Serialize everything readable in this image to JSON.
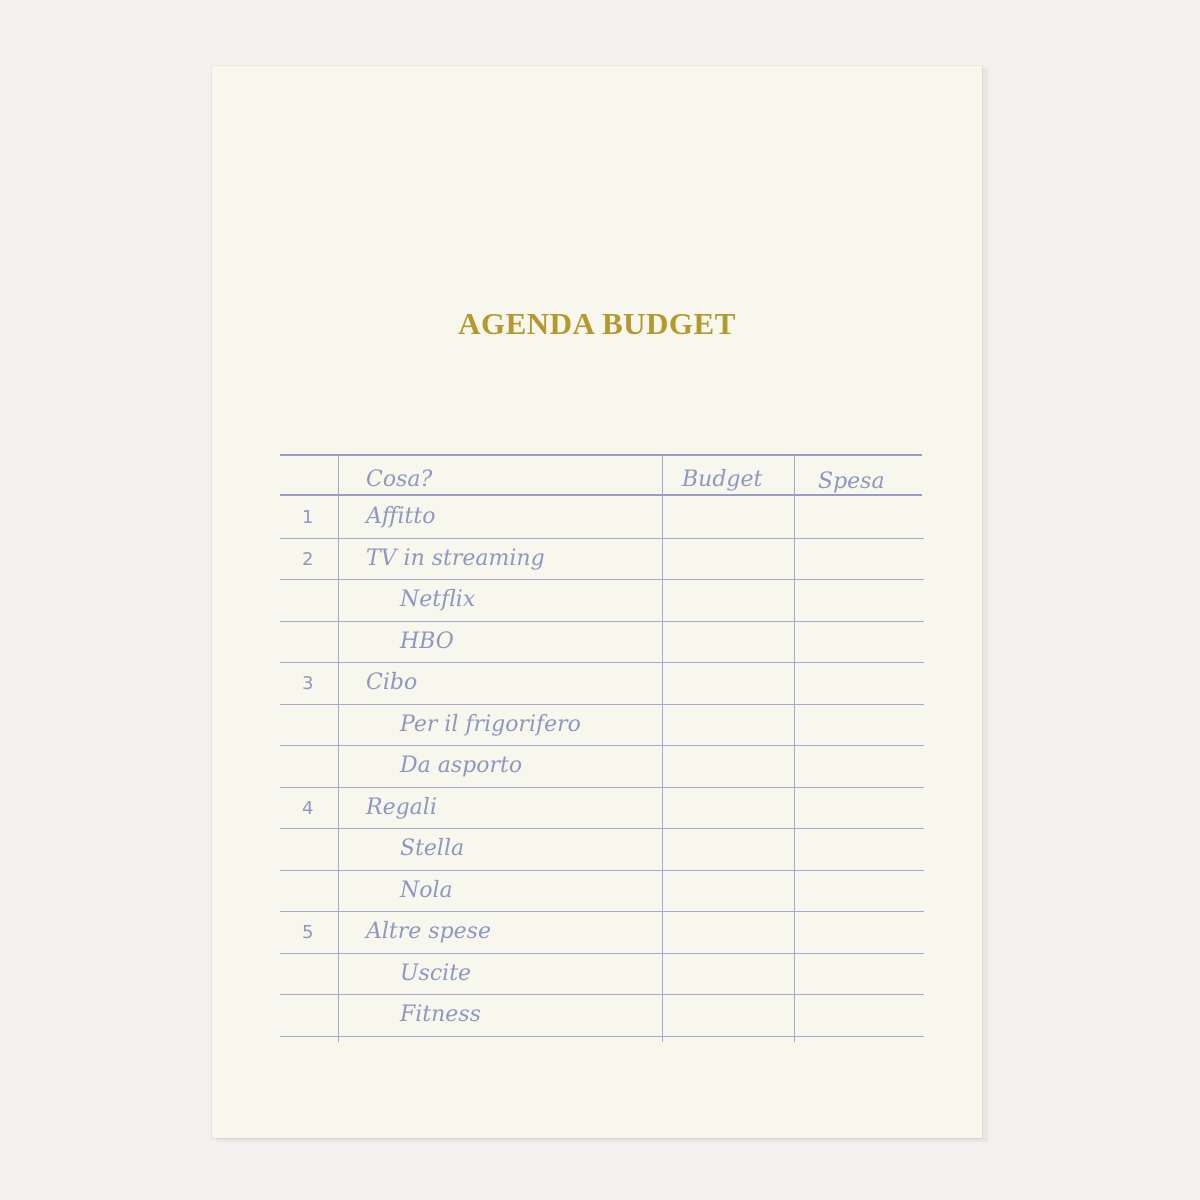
{
  "title": "AGENDA BUDGET",
  "table": {
    "headers": {
      "what": "Cosa?",
      "budget": "Budget",
      "spent": "Spesa"
    },
    "rows": [
      {
        "num": "1",
        "label": "Affitto",
        "indent": false
      },
      {
        "num": "2",
        "label": "TV in streaming",
        "indent": false
      },
      {
        "num": "",
        "label": "Netflix",
        "indent": true
      },
      {
        "num": "",
        "label": "HBO",
        "indent": true
      },
      {
        "num": "3",
        "label": "Cibo",
        "indent": false
      },
      {
        "num": "",
        "label": "Per il frigorifero",
        "indent": true
      },
      {
        "num": "",
        "label": "Da asporto",
        "indent": true
      },
      {
        "num": "4",
        "label": "Regali",
        "indent": false
      },
      {
        "num": "",
        "label": "Stella",
        "indent": true
      },
      {
        "num": "",
        "label": "Nola",
        "indent": true
      },
      {
        "num": "5",
        "label": "Altre spese",
        "indent": false
      },
      {
        "num": "",
        "label": "Uscite",
        "indent": true
      },
      {
        "num": "",
        "label": "Fitness",
        "indent": true
      }
    ]
  }
}
